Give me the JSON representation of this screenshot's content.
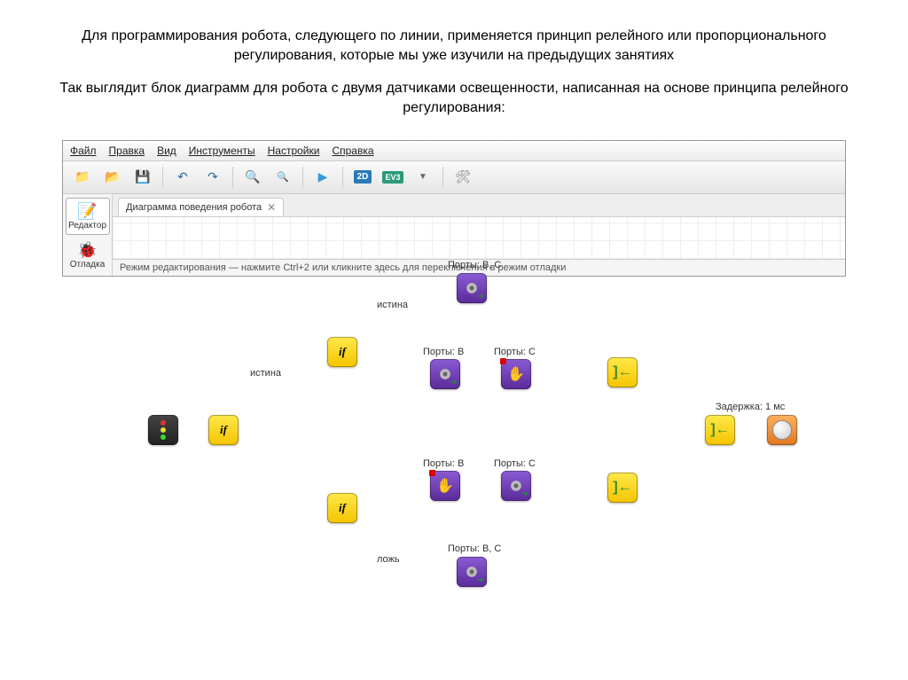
{
  "header": {
    "p1": "Для программирования робота, следующего по линии, применяется принцип релейного или пропорционального регулирования, которые мы уже изучили на предыдущих занятиях",
    "p2": "Так выглядит блок диаграмм для робота с двумя датчиками освещенности, написанная на основе принципа релейного регулирования:"
  },
  "menu": {
    "file": "Файл",
    "edit": "Правка",
    "view": "Вид",
    "tools": "Инструменты",
    "settings": "Настройки",
    "help": "Справка"
  },
  "toolbar": {
    "mode2d": "2D",
    "ev3": "EV3"
  },
  "sidebar": {
    "editor": "Редактор",
    "debug": "Отладка"
  },
  "tab": {
    "title": "Диаграмма поведения робота",
    "close": "✕"
  },
  "labels": {
    "ports_bc_1": "Порты: B, C",
    "ports_bc_2": "Порты: B, C",
    "ports_b_1": "Порты: B",
    "ports_c_1": "Порты: C",
    "ports_b_2": "Порты: B",
    "ports_c_2": "Порты: C",
    "true_1": "истина",
    "true_2": "истина",
    "false_1": "ложь",
    "delay": "Задержка: 1 мс"
  },
  "status": "Режим редактирования — нажмите Ctrl+2 или кликните здесь для переключения в режим отладки",
  "icons": {
    "if": "if"
  }
}
